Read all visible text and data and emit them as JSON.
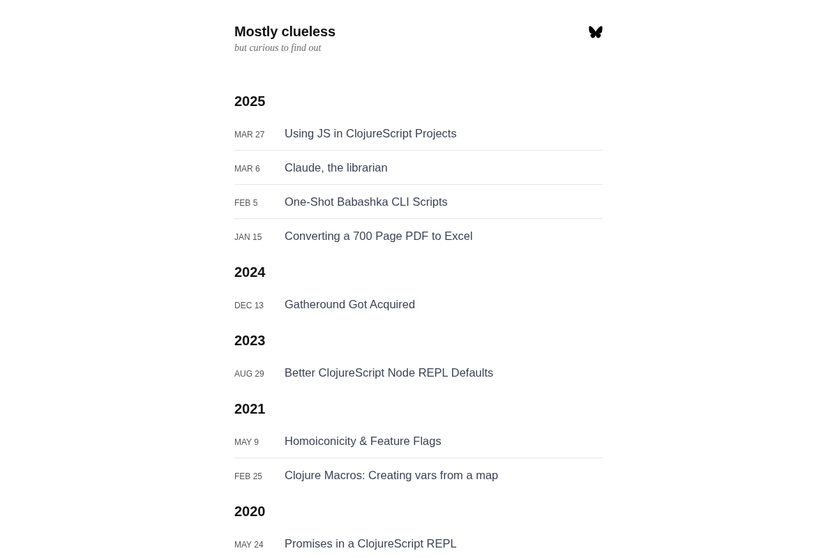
{
  "site": {
    "title": "Mostly clueless",
    "tagline": "but curious to find out"
  },
  "years": [
    {
      "year": "2025",
      "posts": [
        {
          "date": "MAR 27",
          "title": "Using JS in ClojureScript Projects"
        },
        {
          "date": "MAR 6",
          "title": "Claude, the librarian"
        },
        {
          "date": "FEB 5",
          "title": "One-Shot Babashka CLI Scripts"
        },
        {
          "date": "JAN 15",
          "title": "Converting a 700 Page PDF to Excel"
        }
      ]
    },
    {
      "year": "2024",
      "posts": [
        {
          "date": "DEC 13",
          "title": "Gatheround Got Acquired"
        }
      ]
    },
    {
      "year": "2023",
      "posts": [
        {
          "date": "AUG 29",
          "title": "Better ClojureScript Node REPL Defaults"
        }
      ]
    },
    {
      "year": "2021",
      "posts": [
        {
          "date": "MAY 9",
          "title": "Homoiconicity & Feature Flags"
        },
        {
          "date": "FEB 25",
          "title": "Clojure Macros: Creating vars from a map"
        }
      ]
    },
    {
      "year": "2020",
      "posts": [
        {
          "date": "MAY 24",
          "title": "Promises in a ClojureScript REPL"
        }
      ]
    }
  ]
}
